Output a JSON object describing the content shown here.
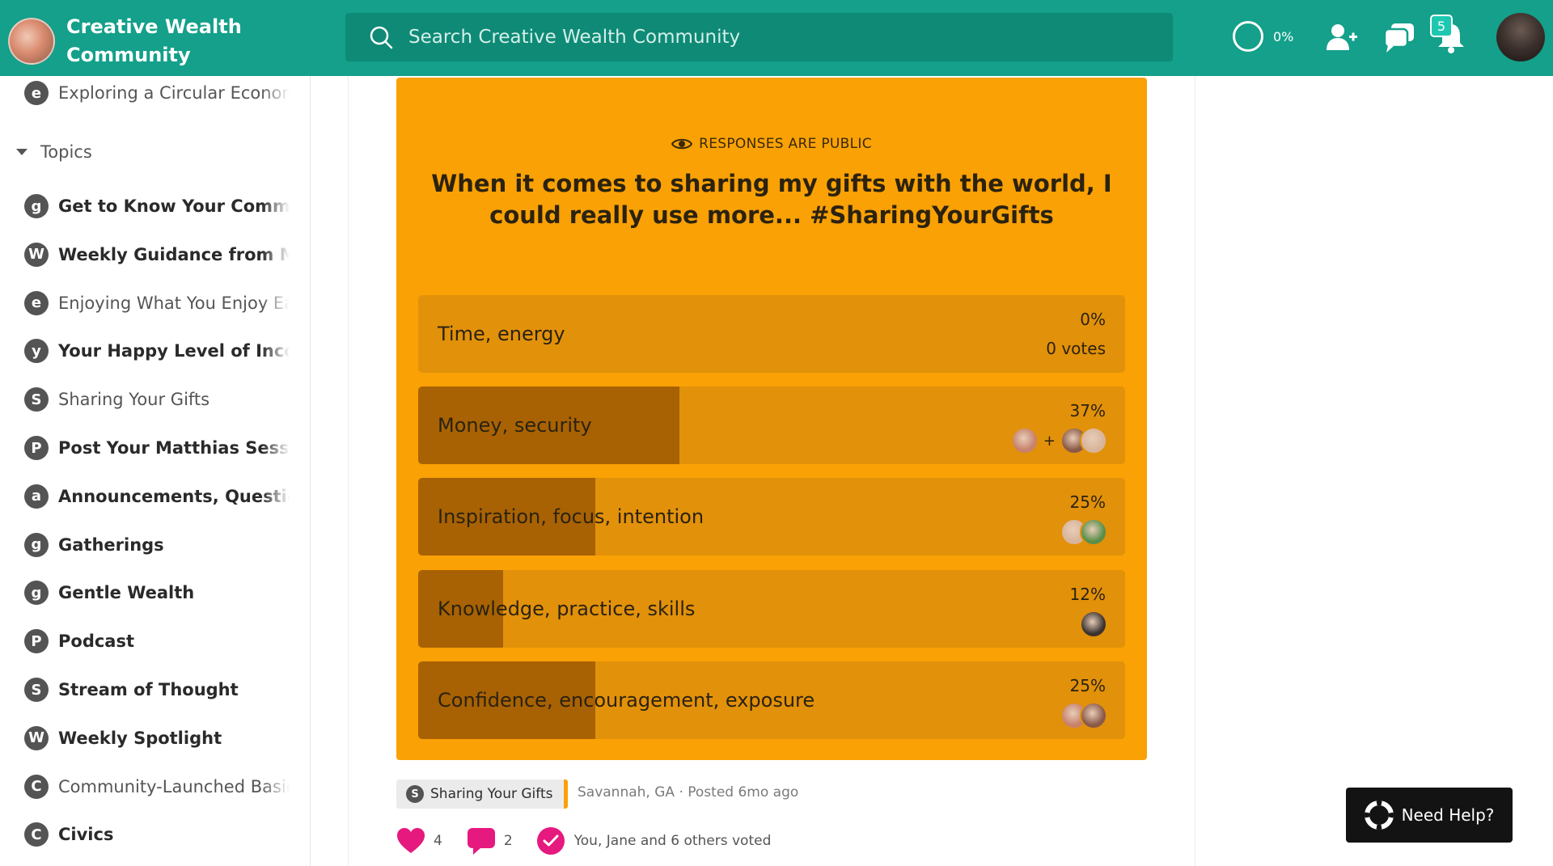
{
  "header": {
    "brand_name": "Creative Wealth Community",
    "search_placeholder": "Search Creative Wealth Community",
    "progress": "0%",
    "notification_count": "5"
  },
  "sidebar": {
    "top_item": {
      "badge": "e",
      "label": "Exploring a Circular Economy",
      "style": "light"
    },
    "topics_label": "Topics",
    "items": [
      {
        "badge": "g",
        "label": "Get to Know Your Community",
        "style": "bold"
      },
      {
        "badge": "W",
        "label": "Weekly Guidance from Matthias",
        "style": "bold"
      },
      {
        "badge": "e",
        "label": "Enjoying What You Enjoy Easily",
        "style": "light"
      },
      {
        "badge": "y",
        "label": "Your Happy Level of Income",
        "style": "bold"
      },
      {
        "badge": "S",
        "label": "Sharing Your Gifts",
        "style": "light"
      },
      {
        "badge": "P",
        "label": "Post Your Matthias Session",
        "style": "bold"
      },
      {
        "badge": "a",
        "label": "Announcements, Questions",
        "style": "bold"
      },
      {
        "badge": "g",
        "label": "Gatherings",
        "style": "bold"
      },
      {
        "badge": "g",
        "label": "Gentle Wealth",
        "style": "bold"
      },
      {
        "badge": "P",
        "label": "Podcast",
        "style": "bold"
      },
      {
        "badge": "S",
        "label": "Stream of Thought",
        "style": "bold"
      },
      {
        "badge": "W",
        "label": "Weekly Spotlight",
        "style": "bold"
      },
      {
        "badge": "C",
        "label": "Community-Launched Basic Income",
        "style": "light"
      },
      {
        "badge": "C",
        "label": "Civics",
        "style": "bold"
      }
    ]
  },
  "poll": {
    "visibility_note": "RESPONSES ARE PUBLIC",
    "question": "When it comes to sharing my gifts with the world, I could really use more... #SharingYourGifts",
    "options": [
      {
        "label": "Time, energy",
        "percent": "0%",
        "fraction": 0,
        "votes_text": "0 votes",
        "voters": 0,
        "has_plus": false
      },
      {
        "label": "Money, security",
        "percent": "37%",
        "fraction": 0.37,
        "votes_text": "",
        "voters": 3,
        "has_plus": true
      },
      {
        "label": "Inspiration, focus, intention",
        "percent": "25%",
        "fraction": 0.25,
        "votes_text": "",
        "voters": 2,
        "has_plus": false
      },
      {
        "label": "Knowledge, practice, skills",
        "percent": "12%",
        "fraction": 0.12,
        "votes_text": "",
        "voters": 1,
        "has_plus": false
      },
      {
        "label": "Confidence, encouragement, exposure",
        "percent": "25%",
        "fraction": 0.25,
        "votes_text": "",
        "voters": 2,
        "has_plus": false
      }
    ]
  },
  "post_footer": {
    "tag_badge": "S",
    "tag_label": "Sharing Your Gifts",
    "meta": "Savannah, GA ·  Posted 6mo ago",
    "like_count": "4",
    "comment_count": "2",
    "voted_text": "You, Jane and 6 others voted"
  },
  "help_label": "Need Help?",
  "colors": {
    "header": "#14a08a",
    "poll_background": "#f9a105",
    "option_background": "#e2910a",
    "option_fill": "#a86203",
    "accent_pink": "#e6197f"
  }
}
